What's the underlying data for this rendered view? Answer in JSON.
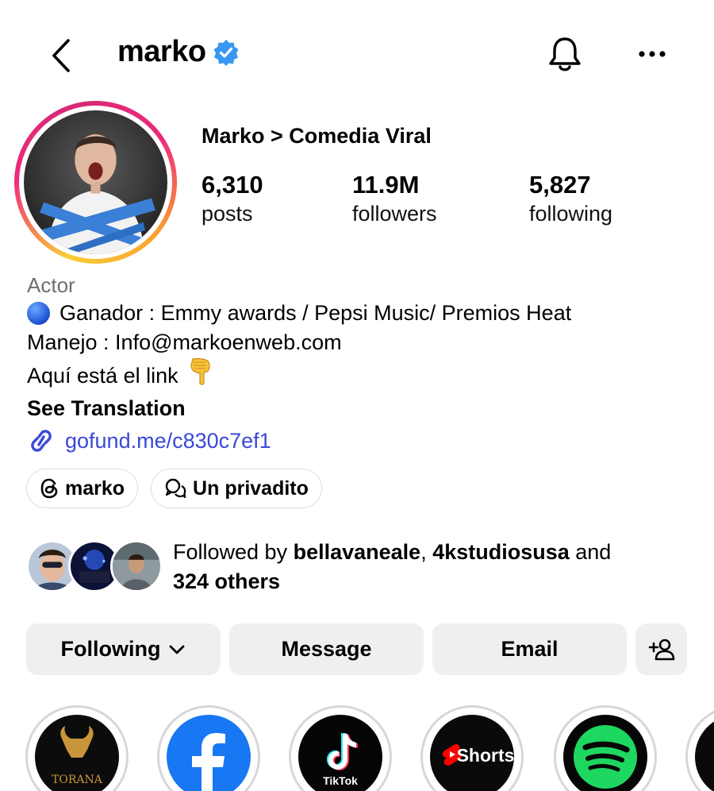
{
  "header": {
    "username": "marko",
    "icons": {
      "back": "chevron-left-icon",
      "verified": "verified-badge-icon",
      "notifications": "bell-icon",
      "more": "more-horizontal-icon"
    },
    "verified_color": "#3897f0"
  },
  "profile": {
    "display_name": "Marko > Comedia Viral",
    "stats": [
      {
        "value": "6,310",
        "label": "posts"
      },
      {
        "value": "11.9M",
        "label": "followers"
      },
      {
        "value": "5,827",
        "label": "following"
      }
    ],
    "category": "Actor",
    "bio_lines": [
      "Ganador : Emmy awards / Pepsi Music/ Premios Heat",
      "Manejo : Info@markoenweb.com",
      "Aquí está el link"
    ],
    "see_translation": "See Translation",
    "link": "gofund.me/c830c7ef1",
    "link_color": "#3949d6"
  },
  "chips": [
    {
      "label": "marko",
      "icon": "threads-icon"
    },
    {
      "label": "Un privadito",
      "icon": "chat-bubbles-icon"
    }
  ],
  "followed_by": {
    "prefix": "Followed by ",
    "user1": "bellavaneale",
    "sep": ", ",
    "user2": "4kstudiosusa",
    "and": " and",
    "others": "324 others"
  },
  "actions": {
    "following": "Following",
    "message": "Message",
    "email": "Email",
    "add_person_icon": "add-person-icon"
  },
  "highlights": [
    {
      "name": "torana",
      "text": "TORANA"
    },
    {
      "name": "facebook",
      "text": "f"
    },
    {
      "name": "tiktok",
      "text": "TikTok"
    },
    {
      "name": "shorts",
      "text": "Shorts"
    },
    {
      "name": "spotify",
      "text": ""
    },
    {
      "name": "partial",
      "text": ""
    }
  ]
}
